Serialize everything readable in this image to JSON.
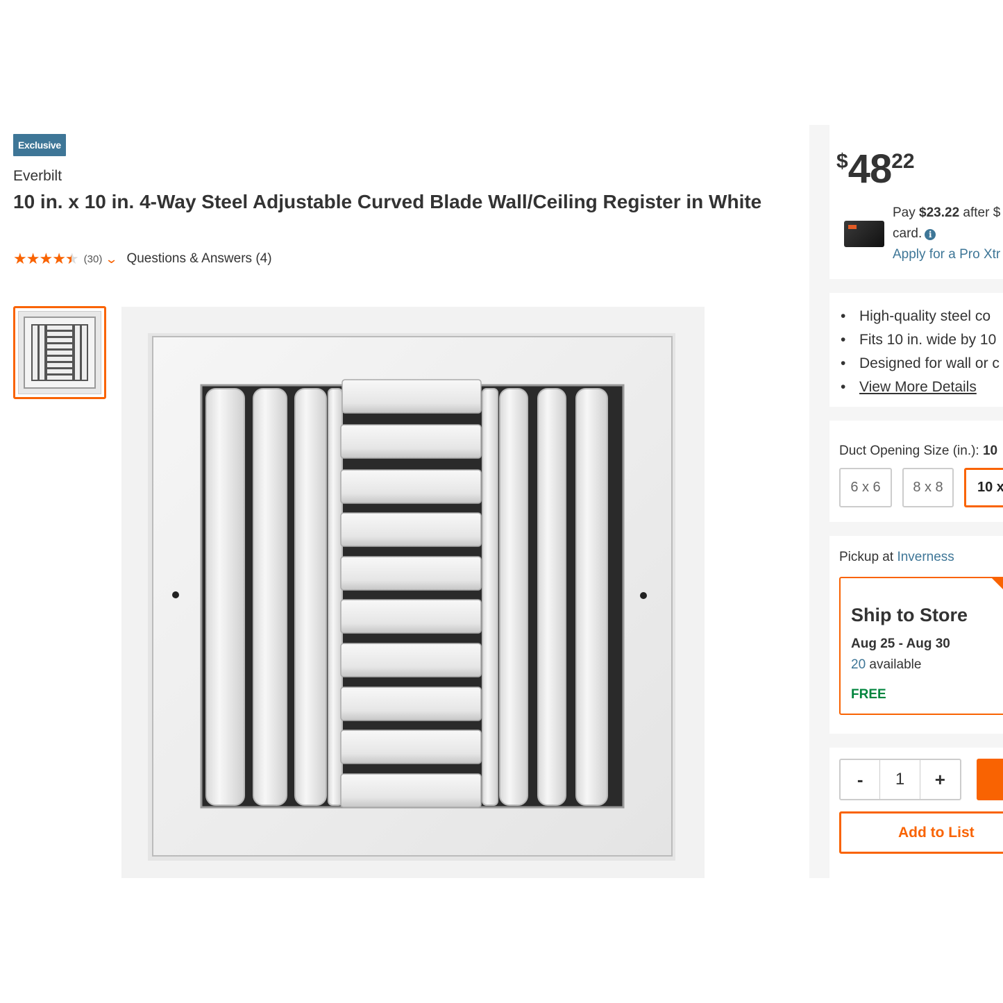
{
  "product": {
    "badge": "Exclusive",
    "brand": "Everbilt",
    "title": "10 in. x 10 in. 4-Way Steel Adjustable Curved Blade Wall/Ceiling Register in White",
    "rating_value": 4.5,
    "review_count": "(30)",
    "qa_link": "Questions & Answers (4)"
  },
  "price": {
    "dollar_sign": "$",
    "whole": "48",
    "cents": "22"
  },
  "financing": {
    "line1_prefix": "Pay ",
    "line1_amount": "$23.22",
    "line1_suffix": " after $",
    "line2": "card.",
    "info_icon": "i",
    "apply_link": "Apply for a Pro Xtr"
  },
  "highlights": [
    "High-quality steel co",
    "Fits 10 in. wide by 10",
    "Designed for wall or c",
    "View More Details"
  ],
  "size_selector": {
    "label": "Duct Opening Size (in.): ",
    "selected_value": "10",
    "options": [
      "6 x 6",
      "8 x 8",
      "10 x"
    ]
  },
  "pickup": {
    "label_prefix": "Pickup at ",
    "store": "Inverness",
    "option_title": "Ship to Store",
    "dates": "Aug 25 - Aug 30",
    "available_count": "20",
    "available_suffix": " available",
    "cost": "FREE",
    "check_icon": "✓"
  },
  "cart": {
    "minus": "-",
    "quantity": "1",
    "plus": "+",
    "add_to_list": "Add to List"
  },
  "colors": {
    "accent_orange": "#f96302",
    "badge_blue": "#3e7697",
    "link_blue": "#3e7697",
    "free_green": "#00853d"
  }
}
